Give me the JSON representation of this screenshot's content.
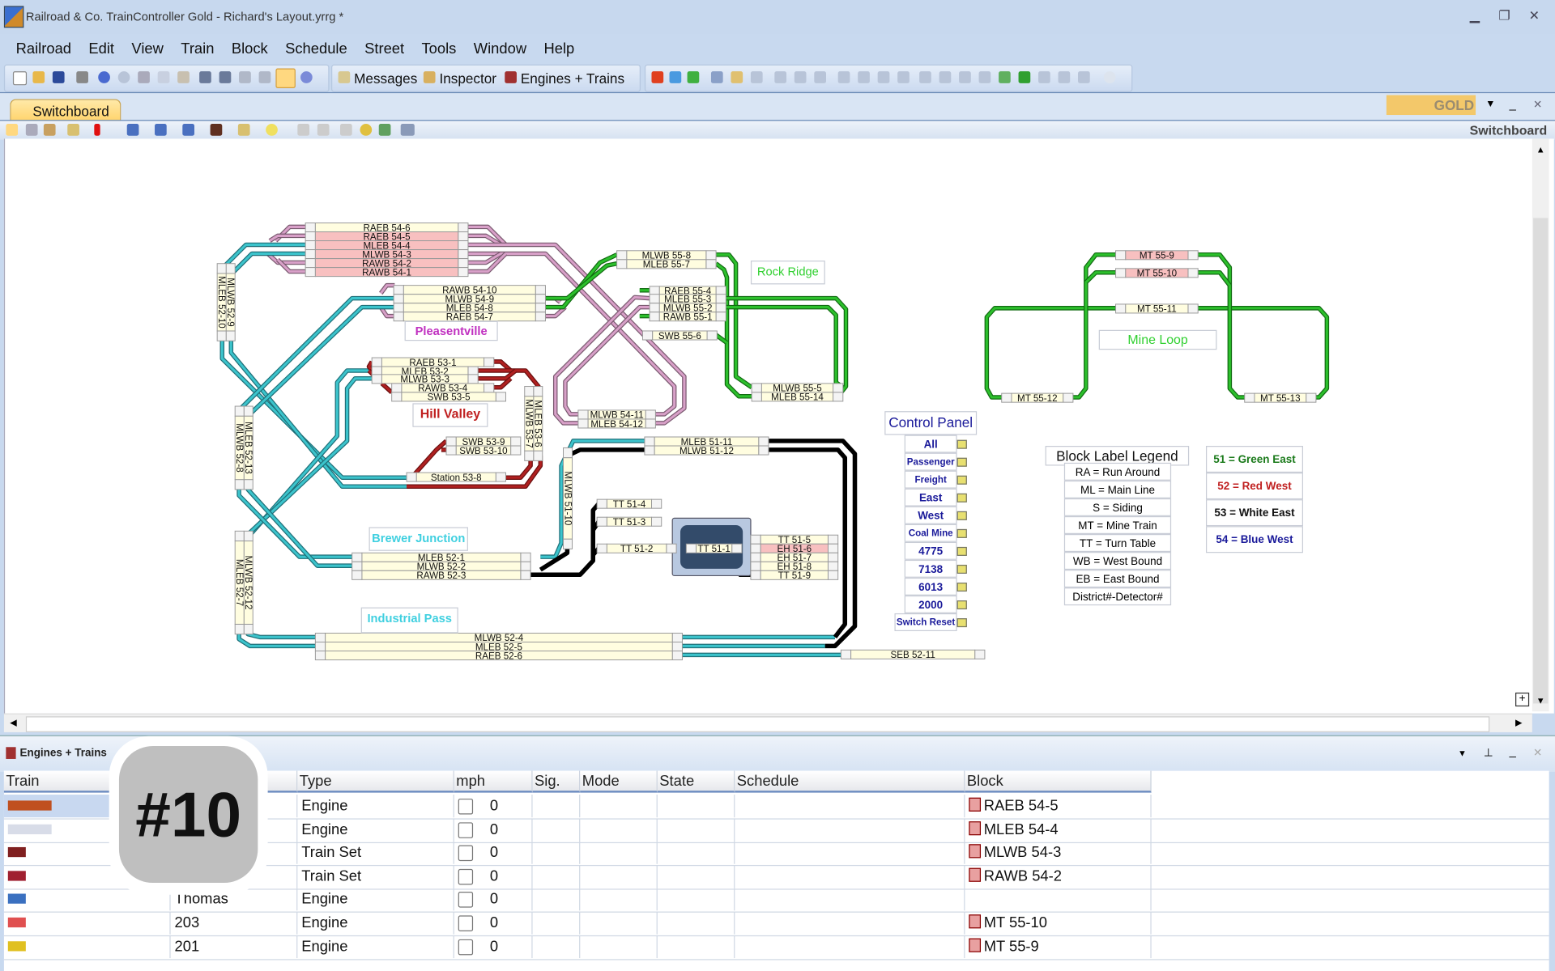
{
  "window": {
    "title": "Railroad & Co. TrainController Gold - Richard's Layout.yrrg *"
  },
  "menu": [
    "Railroad",
    "Edit",
    "View",
    "Train",
    "Block",
    "Schedule",
    "Street",
    "Tools",
    "Window",
    "Help"
  ],
  "toolbar": {
    "messages": "Messages",
    "inspector": "Inspector",
    "engines_trains": "Engines + Trains"
  },
  "tab": {
    "label": "Switchboard",
    "brand": "GOLD",
    "panel_title": "Switchboard"
  },
  "layout": {
    "blocks": [
      {
        "label": "RAEB 54-6",
        "occupied": false
      },
      {
        "label": "RAEB 54-5",
        "occupied": true
      },
      {
        "label": "MLEB 54-4",
        "occupied": true
      },
      {
        "label": "MLWB 54-3",
        "occupied": true
      },
      {
        "label": "RAWB 54-2",
        "occupied": true
      },
      {
        "label": "RAWB 54-1",
        "occupied": true
      },
      {
        "label": "RAWB 54-10",
        "occupied": false
      },
      {
        "label": "MLWB 54-9",
        "occupied": false
      },
      {
        "label": "MLEB 54-8",
        "occupied": false
      },
      {
        "label": "RAEB 54-7",
        "occupied": false
      },
      {
        "label": "MLWB 52-9",
        "occupied": false
      },
      {
        "label": "MLEB 52-10",
        "occupied": false
      },
      {
        "label": "RAEB 53-1",
        "occupied": false
      },
      {
        "label": "MLEB 53-2",
        "occupied": false
      },
      {
        "label": "MLWB 53-3",
        "occupied": false
      },
      {
        "label": "RAWB 53-4",
        "occupied": false
      },
      {
        "label": "SWB 53-5",
        "occupied": false
      },
      {
        "label": "MLEB 53-6",
        "occupied": false
      },
      {
        "label": "MLWB 53-7",
        "occupied": false
      },
      {
        "label": "SWB 53-9",
        "occupied": false
      },
      {
        "label": "SWB 53-10",
        "occupied": false
      },
      {
        "label": "Station 53-8",
        "occupied": false
      },
      {
        "label": "MLEB 52-13",
        "occupied": false
      },
      {
        "label": "MLWB 52-8",
        "occupied": false
      },
      {
        "label": "MLWB 52-12",
        "occupied": false
      },
      {
        "label": "MLEB 52-7",
        "occupied": false
      },
      {
        "label": "MLEB 52-1",
        "occupied": false
      },
      {
        "label": "MLWB 52-2",
        "occupied": false
      },
      {
        "label": "RAWB 52-3",
        "occupied": false
      },
      {
        "label": "MLWB 52-4",
        "occupied": false
      },
      {
        "label": "MLEB 52-5",
        "occupied": false
      },
      {
        "label": "RAEB 52-6",
        "occupied": false
      },
      {
        "label": "SEB 52-11",
        "occupied": false
      },
      {
        "label": "MLWB 51-10",
        "occupied": false
      },
      {
        "label": "MLEB 51-11",
        "occupied": false
      },
      {
        "label": "MLWB 51-12",
        "occupied": false
      },
      {
        "label": "TT 51-4",
        "occupied": false
      },
      {
        "label": "TT 51-3",
        "occupied": false
      },
      {
        "label": "TT 51-2",
        "occupied": false
      },
      {
        "label": "TT 51-1",
        "occupied": false
      },
      {
        "label": "TT 51-5",
        "occupied": false
      },
      {
        "label": "EH 51-6",
        "occupied": true
      },
      {
        "label": "EH 51-7",
        "occupied": false
      },
      {
        "label": "EH 51-8",
        "occupied": false
      },
      {
        "label": "TT 51-9",
        "occupied": false
      },
      {
        "label": "MLWB 55-8",
        "occupied": false
      },
      {
        "label": "MLEB 55-7",
        "occupied": false
      },
      {
        "label": "RAEB 55-4",
        "occupied": false
      },
      {
        "label": "MLEB 55-3",
        "occupied": false
      },
      {
        "label": "MLWB 55-2",
        "occupied": false
      },
      {
        "label": "RAWB 55-1",
        "occupied": false
      },
      {
        "label": "SWB 55-6",
        "occupied": false
      },
      {
        "label": "MLWB 55-5",
        "occupied": false
      },
      {
        "label": "MLEB 55-14",
        "occupied": false
      },
      {
        "label": "MLWB 54-11",
        "occupied": false
      },
      {
        "label": "MLEB 54-12",
        "occupied": false
      },
      {
        "label": "MT 55-9",
        "occupied": true
      },
      {
        "label": "MT 55-10",
        "occupied": true
      },
      {
        "label": "MT 55-11",
        "occupied": false
      },
      {
        "label": "MT 55-12",
        "occupied": false
      },
      {
        "label": "MT 55-13",
        "occupied": false
      }
    ],
    "regions": {
      "pleasentville": "Pleasentville",
      "hill_valley": "Hill Valley",
      "rock_ridge": "Rock Ridge",
      "mine_loop": "Mine Loop",
      "brewer_junction": "Brewer Junction",
      "industrial_pass": "Industrial Pass"
    },
    "control_panel": {
      "title": "Control Panel",
      "items": [
        "All",
        "Passenger",
        "Freight",
        "East",
        "West",
        "Coal Mine",
        "4775",
        "7138",
        "6013",
        "2000",
        "Switch Reset"
      ]
    },
    "legend": {
      "title": "Block Label Legend",
      "items": [
        "RA = Run Around",
        "ML = Main Line",
        "S = Siding",
        "MT = Mine Train",
        "TT = Turn Table",
        "WB = West Bound",
        "EB = East Bound",
        "District#-Detector#"
      ]
    },
    "color_legend": [
      {
        "text": "51 = Green East",
        "color": "#1a7a1a"
      },
      {
        "text": "52 = Red West",
        "color": "#c02020"
      },
      {
        "text": "53 = White East",
        "color": "#111111"
      },
      {
        "text": "54 = Blue West",
        "color": "#1a1a9a"
      }
    ],
    "track_colors": {
      "district51": "#000000",
      "district52": "#3cc4cc",
      "district53": "#b02020",
      "district54": "#d8a0c8",
      "district55": "#2cc02c"
    }
  },
  "engines_panel": {
    "title": "Engines + Trains",
    "columns": [
      "Train",
      "",
      "Type",
      "mph",
      "Sig.",
      "Mode",
      "State",
      "Schedule",
      "Block"
    ],
    "rows": [
      {
        "name": "",
        "type": "Engine",
        "mph": "0",
        "block": "RAEB 54-5"
      },
      {
        "name": "",
        "type": "Engine",
        "mph": "0",
        "block": "MLEB 54-4"
      },
      {
        "name": "",
        "type": "Train Set",
        "mph": "0",
        "block": "MLWB 54-3"
      },
      {
        "name": "",
        "type": "Train Set",
        "mph": "0",
        "block": "RAWB 54-2"
      },
      {
        "name": "Thomas",
        "type": "Engine",
        "mph": "0",
        "block": ""
      },
      {
        "name": "203",
        "type": "Engine",
        "mph": "0",
        "block": "MT 55-10"
      },
      {
        "name": "201",
        "type": "Engine",
        "mph": "0",
        "block": "MT 55-9"
      }
    ]
  },
  "overlay_badge": "#10"
}
